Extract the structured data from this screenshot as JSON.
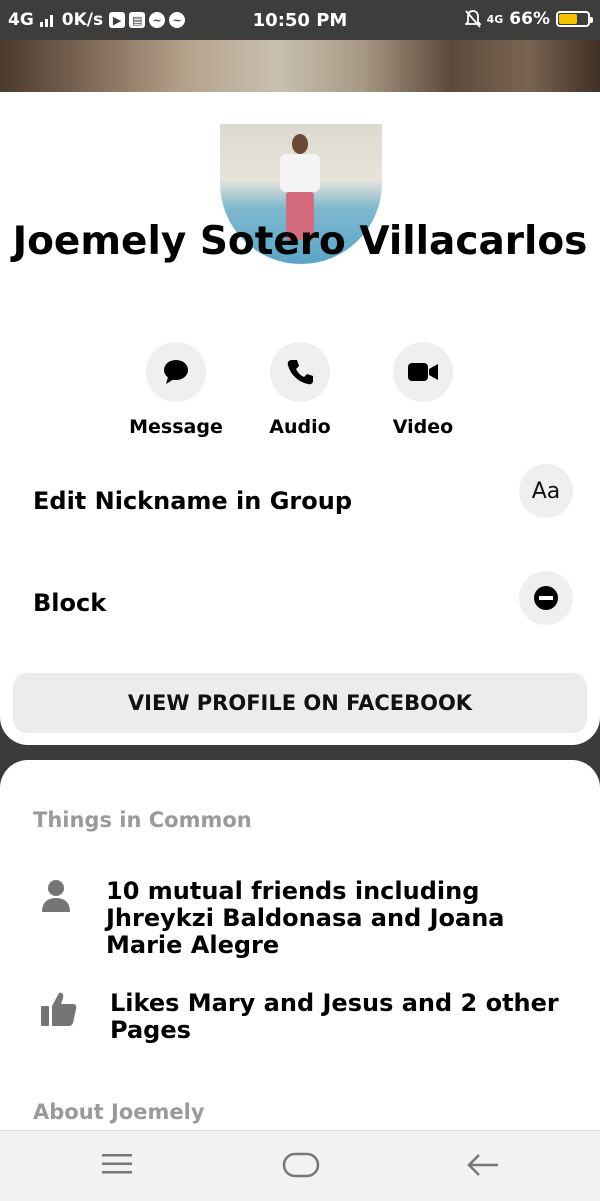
{
  "status_bar": {
    "network": "4G",
    "speed": "0K/s",
    "time": "10:50 PM",
    "net_right": "4G",
    "battery": "66%",
    "battery_fill": 0.66,
    "icons": [
      "play-store-icon",
      "sim-icon",
      "messenger-icon",
      "messenger-icon"
    ]
  },
  "profile": {
    "name": "Joemely Sotero Villacarlos"
  },
  "actions": [
    {
      "label": "Message",
      "icon": "chat-bubble-icon"
    },
    {
      "label": "Audio",
      "icon": "phone-icon"
    },
    {
      "label": "Video",
      "icon": "video-camera-icon"
    }
  ],
  "options": {
    "nickname_label": "Edit Nickname in Group",
    "nickname_btn": "Aa",
    "block_label": "Block",
    "view_profile": "VIEW PROFILE ON FACEBOOK"
  },
  "things_in_common": {
    "title": "Things in Common",
    "items": [
      {
        "text": "10 mutual friends including Jhreykzi Baldonasa and Joana Marie Alegre",
        "icon": "person-icon"
      },
      {
        "text": "Likes Mary and Jesus and 2 other Pages",
        "icon": "thumbs-up-icon"
      }
    ]
  },
  "about": {
    "title": "About Joemely"
  },
  "navbar": {
    "icons": [
      "menu-icon",
      "home-icon",
      "back-icon"
    ]
  },
  "colors": {
    "status_bg": "#3d3d3d",
    "battery": "#f5c400",
    "button_bg": "#efefef",
    "section_title": "#9a9a9a"
  }
}
